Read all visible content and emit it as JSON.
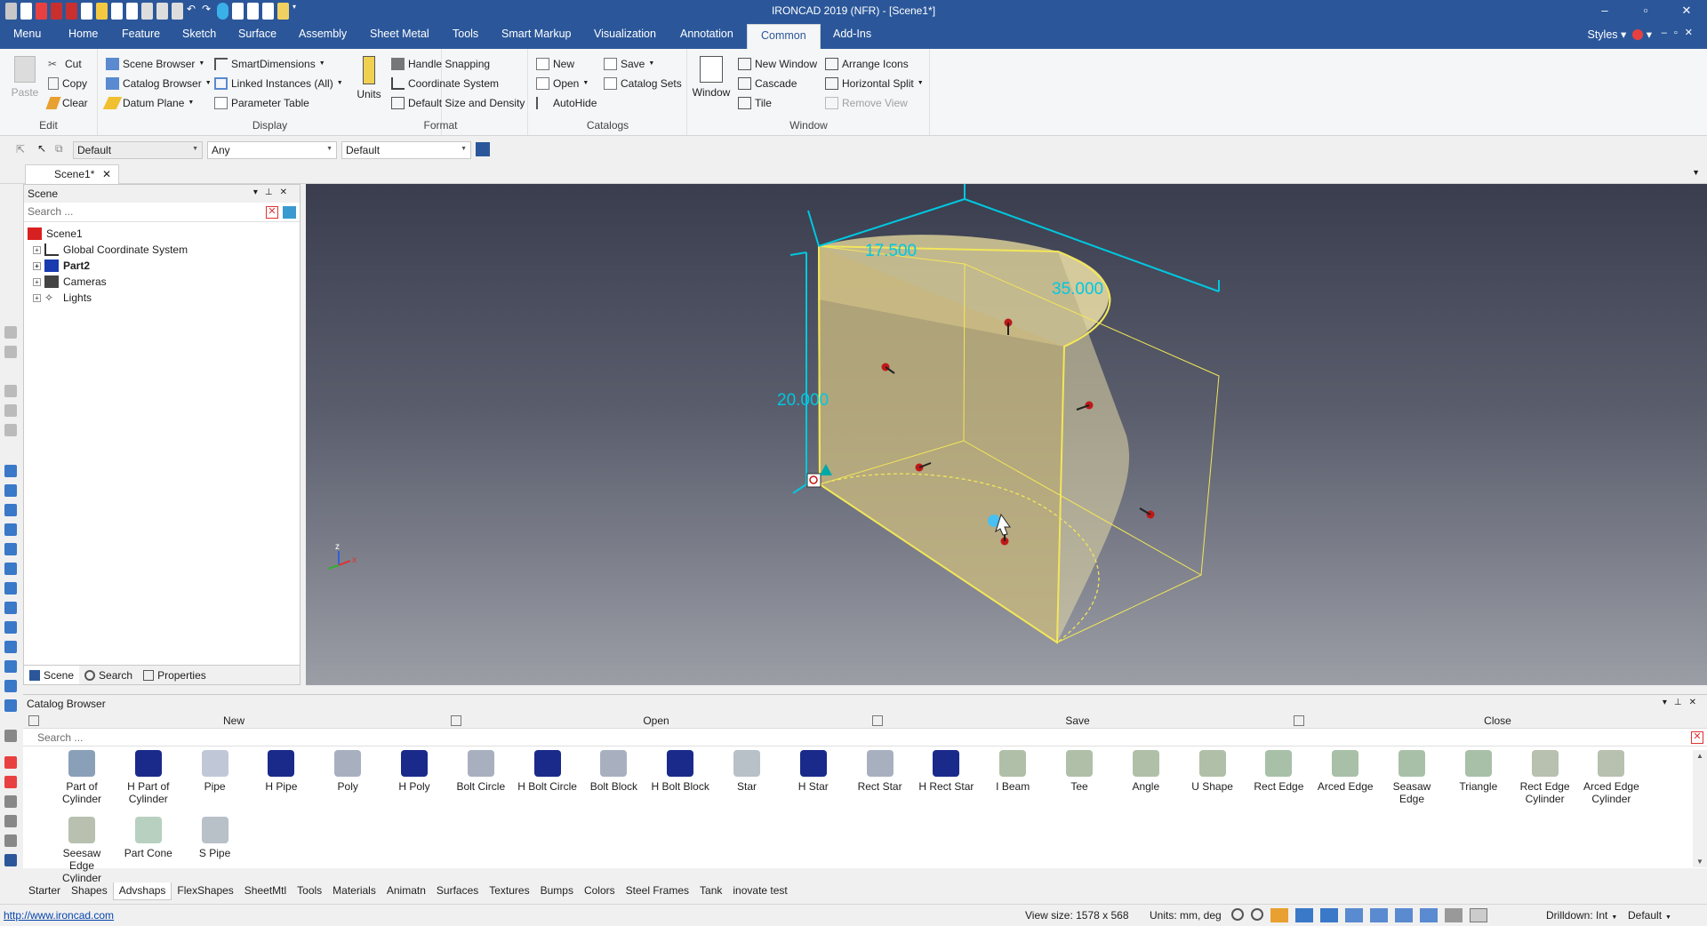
{
  "titlebar": {
    "title": "IRONCAD 2019 (NFR) - [Scene1*]",
    "controls": [
      "–",
      "▫",
      "✕"
    ]
  },
  "ribbon_tabs": [
    "Menu",
    "Home",
    "Feature",
    "Sketch",
    "Surface",
    "Assembly",
    "Sheet Metal",
    "Tools",
    "Smart Markup",
    "Visualization",
    "Annotation",
    "Common",
    "Add-Ins"
  ],
  "active_tab": "Common",
  "styles_label": "Styles",
  "ribbon": {
    "edit": {
      "label": "Edit",
      "paste": "Paste",
      "cut": "Cut",
      "copy": "Copy",
      "clear": "Clear"
    },
    "display": {
      "label": "Display",
      "scene_browser": "Scene Browser",
      "catalog_browser": "Catalog Browser",
      "datum_plane": "Datum Plane",
      "smart_dimensions": "SmartDimensions",
      "linked_instances": "Linked Instances (All)",
      "parameter_table": "Parameter Table"
    },
    "format": {
      "label": "Format",
      "units": "Units",
      "handle_snapping": "Handle Snapping",
      "coordinate_system": "Coordinate System",
      "default_size": "Default Size and Density"
    },
    "catalogs": {
      "label": "Catalogs",
      "new": "New",
      "open": "Open",
      "autohide": "AutoHide",
      "save": "Save",
      "catalog_sets": "Catalog Sets"
    },
    "window": {
      "label": "Window",
      "window": "Window",
      "new_window": "New Window",
      "cascade": "Cascade",
      "tile": "Tile",
      "arrange_icons": "Arrange Icons",
      "horizontal_split": "Horizontal Split",
      "remove_view": "Remove View"
    }
  },
  "toolrow": {
    "combo1": "Default",
    "combo2": "Any",
    "combo3": "Default"
  },
  "doc_tab": "Scene1*",
  "scene_panel": {
    "title": "Scene",
    "search_placeholder": "Search ...",
    "tree": [
      {
        "label": "Scene1",
        "bold": false
      },
      {
        "label": "Global Coordinate System",
        "bold": false
      },
      {
        "label": "Part2",
        "bold": true
      },
      {
        "label": "Cameras",
        "bold": false
      },
      {
        "label": "Lights",
        "bold": false
      }
    ],
    "footer_tabs": [
      "Scene",
      "Search",
      "Properties"
    ]
  },
  "viewport": {
    "dimensions": [
      "17.500",
      "35.000",
      "20.000"
    ],
    "triad_x": "x",
    "triad_z": "z"
  },
  "catalog": {
    "title": "Catalog Browser",
    "buttons": [
      "New",
      "Open",
      "Save",
      "Close"
    ],
    "search_placeholder": "Search ...",
    "items": [
      "Part of Cylinder",
      "H Part of Cylinder",
      "Pipe",
      "H Pipe",
      "Poly",
      "H Poly",
      "Bolt Circle",
      "H Bolt Circle",
      "Bolt Block",
      "H Bolt Block",
      "Star",
      "H Star",
      "Rect Star",
      "H Rect Star",
      "I Beam",
      "Tee",
      "Angle",
      "U Shape",
      "Rect Edge",
      "Arced Edge",
      "Seasaw Edge",
      "Triangle",
      "Rect Edge Cylinder",
      "Arced Edge Cylinder",
      "Seesaw Edge Cylinder",
      "Part Cone",
      "S Pipe"
    ],
    "tabs": [
      "Starter",
      "Shapes",
      "Advshaps",
      "FlexShapes",
      "SheetMtl",
      "Tools",
      "Materials",
      "Animatn",
      "Surfaces",
      "Textures",
      "Bumps",
      "Colors",
      "Steel Frames",
      "Tank",
      "inovate test"
    ],
    "active_tab": "Advshaps"
  },
  "statusbar": {
    "link": "http://www.ironcad.com",
    "view_size": "View size: 1578 x  568",
    "units": "Units: mm, deg",
    "drilldown": "Drilldown: Int",
    "default": "Default"
  },
  "colors": {
    "accent": "#2b579a",
    "dim": "#00c8e0",
    "part": "#e8d8a0",
    "edge": "#f2e65a"
  }
}
